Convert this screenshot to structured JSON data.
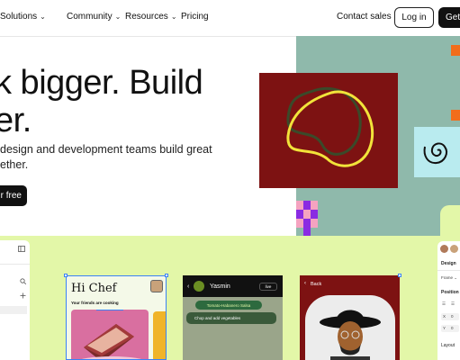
{
  "nav": {
    "items": [
      {
        "label": "Solutions",
        "chevron": true
      },
      {
        "label": "Community",
        "chevron": true
      },
      {
        "label": "Resources",
        "chevron": true
      },
      {
        "label": "Pricing",
        "chevron": false
      }
    ],
    "contact": "Contact sales",
    "login": "Log in",
    "get_started": "Get"
  },
  "hero": {
    "headline_line1": "k bigger. Build",
    "headline_line2": "er.",
    "sub_line1": "design and development teams build great",
    "sub_line2": "ether.",
    "cta": "r free"
  },
  "art": {
    "colors": {
      "teal": "#8fb9ab",
      "maroon": "#7d1212",
      "lime": "#e3f7a8",
      "yellow_line": "#f2e33a",
      "dark_line": "#3a4a2a",
      "purple": "#8a2be2",
      "pink": "#f5a3c0",
      "orange": "#f26d1b",
      "light_blue": "#b9ebef"
    }
  },
  "editor": {
    "left_icons": [
      "sidebar-toggle-icon",
      "search-icon",
      "plus-icon"
    ],
    "frame1": {
      "title": "Hi Chef",
      "subtitle": "Your friends are cooking"
    },
    "frame2": {
      "name": "Yasmin",
      "badge": "live",
      "tag": "Tomato-Habanero Salsa",
      "chat": "Chop and add vegetables"
    },
    "frame3": {
      "back": "Back"
    },
    "right_panel": {
      "tab": "Design",
      "frame_label": "Frame",
      "position": "Position",
      "x_label": "X",
      "y_label": "Y",
      "x_value": "0",
      "y_value": "0",
      "layout": "Layout"
    }
  }
}
